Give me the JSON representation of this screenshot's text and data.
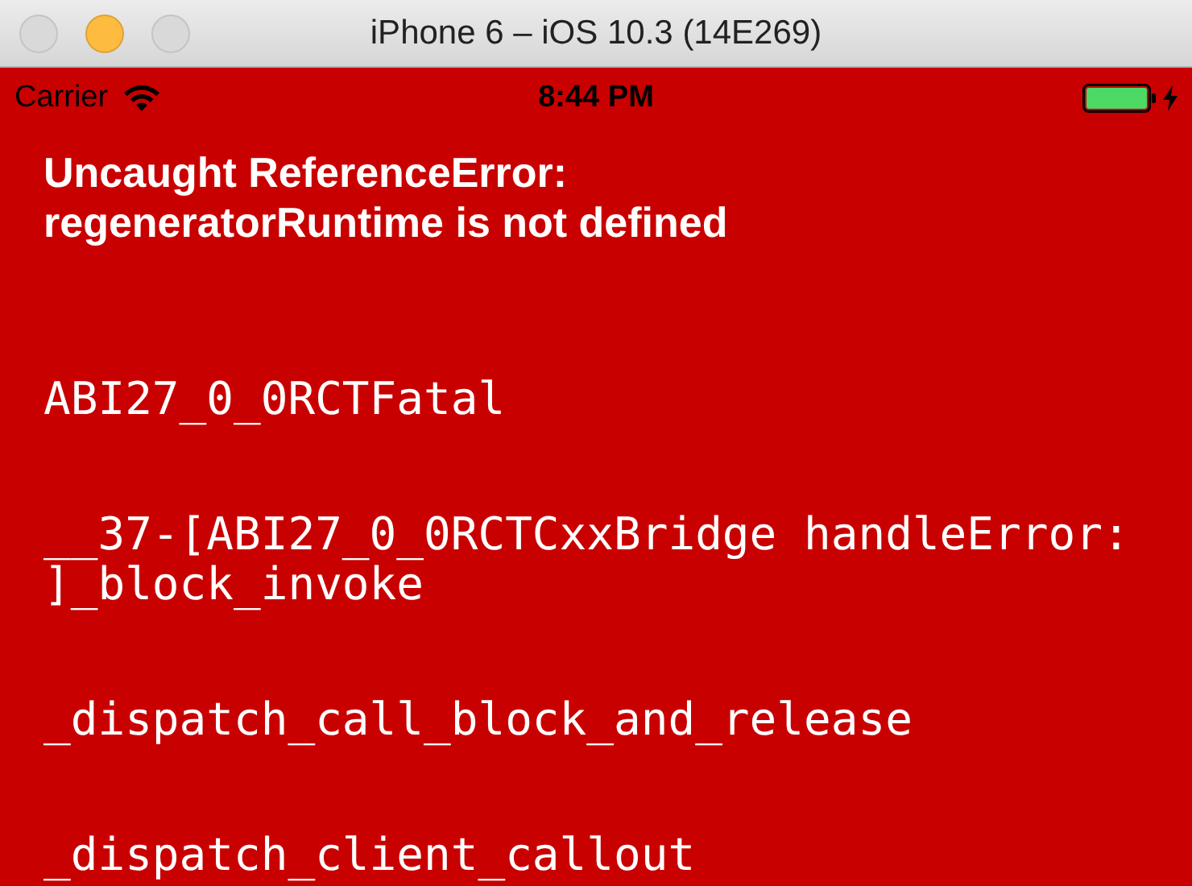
{
  "window": {
    "title": "iPhone 6 – iOS 10.3 (14E269)"
  },
  "status_bar": {
    "carrier": "Carrier",
    "time": "8:44 PM",
    "charging": true
  },
  "error": {
    "message": "Uncaught ReferenceError: regeneratorRuntime is not defined",
    "stack": [
      "ABI27_0_0RCTFatal",
      "__37-[ABI27_0_0RCTCxxBridge handleError:\n]_block_invoke",
      "_dispatch_call_block_and_release",
      "_dispatch_client_callout"
    ]
  }
}
